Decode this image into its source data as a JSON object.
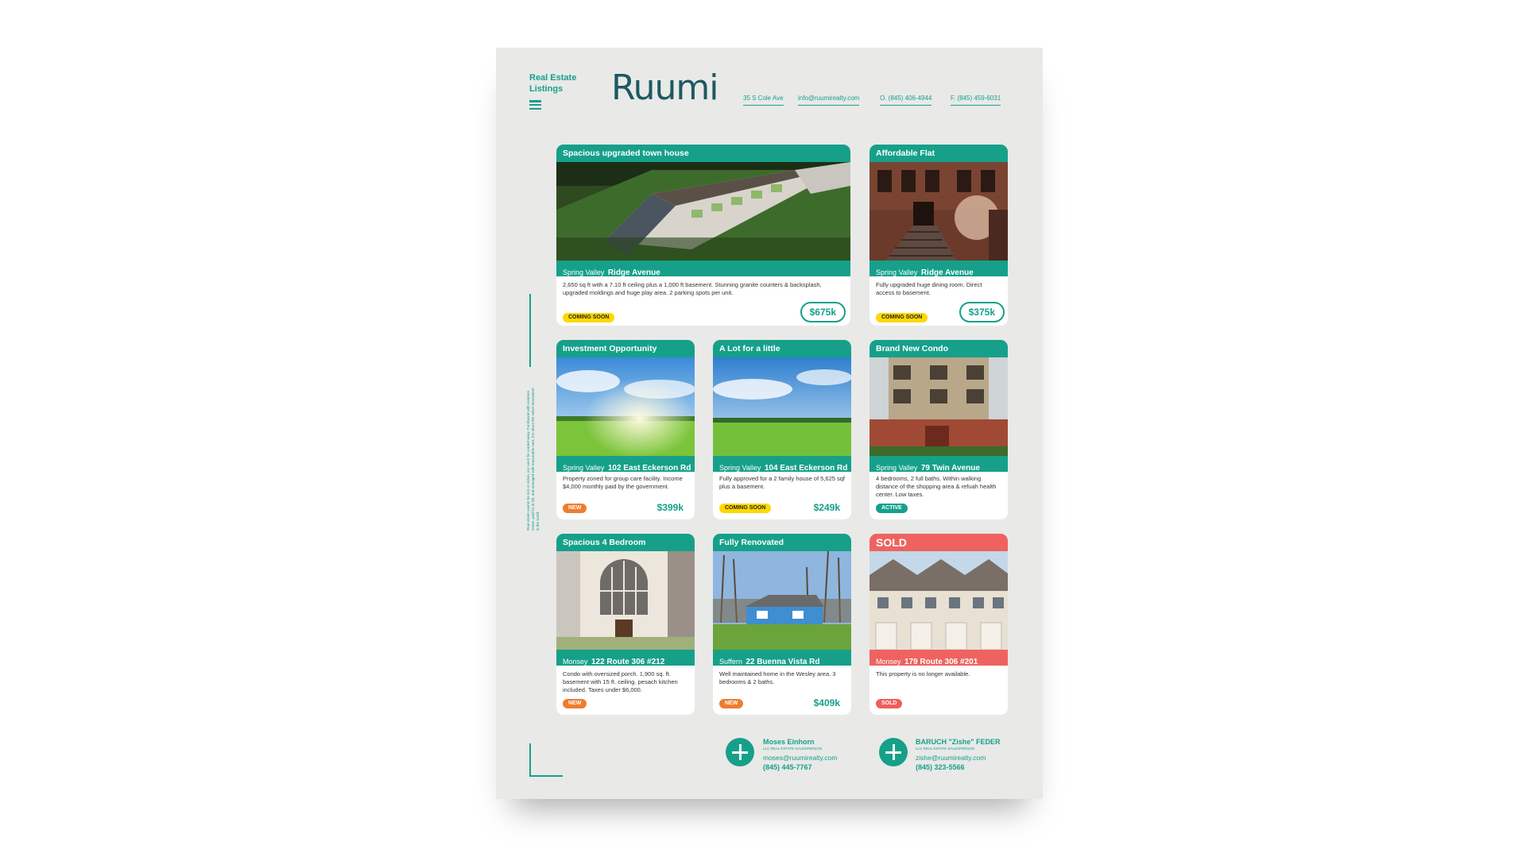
{
  "header": {
    "tagline": "Real Estate Listings",
    "logo": "Ruumi",
    "contacts": [
      "35 S Cole Ave",
      "info@ruumirealty.com",
      "O. (845) 406-4944",
      "F. (845) 459-6031"
    ]
  },
  "side_note": "Real estate cannot be lost or stolen, nor can it be carried away. Purchased with common sense, paid for in full, and managed with reasonable care, it is about the safest investment in the world.",
  "listings": [
    {
      "title": "Spacious upgraded town house",
      "city": "Spring Valley",
      "street": "Ridge Avenue",
      "description": "2,650 sq ft with a 7.10 ft ceiling plus a 1,000 ft basement. Stunning granite counters & backsplash, upgraded moldings and huge play area. 2 parking spots per unit.",
      "status": "COMING SOON",
      "price": "$675k"
    },
    {
      "title": "Affordable Flat",
      "city": "Spring Valley",
      "street": "Ridge Avenue",
      "description": "Fully upgraded huge dining room. Direct access to basement.",
      "status": "COMING SOON",
      "price": "$375k"
    },
    {
      "title": "Investment Opportunity",
      "city": "Spring Valley",
      "street": "102 East Eckerson Rd",
      "description": "Property zoned for group care facility. Income $4,000 monthly paid by the government.",
      "status": "NEW",
      "price": "$399k"
    },
    {
      "title": "A Lot for a little",
      "city": "Spring Valley",
      "street": "104 East Eckerson Rd",
      "description": "Fully approved for a 2 family house of 5,625 sqf plus a basement.",
      "status": "COMING SOON",
      "price": "$249k"
    },
    {
      "title": "Brand New Condo",
      "city": "Spring Valley",
      "street": "79 Twin Avenue",
      "description": "4 bedrooms, 2 full baths. Within walking distance of the shopping area & refuah health center. Low taxes.",
      "status": "ACTIVE",
      "price": ""
    },
    {
      "title": "Spacious 4 Bedroom",
      "city": "Monsey",
      "street": "122 Route 306 #212",
      "description": "Condo with oversized porch. 1,900 sq. ft. basement with 15 ft. ceiling. pesach kitchen included. Taxes under $6,000.",
      "status": "NEW",
      "price": ""
    },
    {
      "title": "Fully Renovated",
      "city": "Suffern",
      "street": "22 Buenna Vista Rd",
      "description": "Well maintained home in the Wesley area. 3 bedrooms & 2 baths.",
      "status": "NEW",
      "price": "$409k"
    },
    {
      "title": "SOLD",
      "city": "Monsey",
      "street": "179 Route 306 #201",
      "description": "This property is no longer available.",
      "status": "SOLD",
      "price": ""
    }
  ],
  "agents": [
    {
      "name": "Moses Einhorn",
      "role": "LLC REAL ESTATE SALESPERSON",
      "email": "moses@ruumirealty.com",
      "phone": "(845) 445-7767"
    },
    {
      "name": "BARUCH \"Zishe\" FEDER",
      "role": "LLC REAL ESTATE SALESPERSON",
      "email": "zishe@ruumirealty.com",
      "phone": "(845) 323-5566"
    }
  ],
  "colors": {
    "accent": "#16a08a",
    "sold": "#ee6360",
    "coming_soon": "#ffd800",
    "new": "#ee7d2e",
    "logo": "#1b5a60"
  }
}
